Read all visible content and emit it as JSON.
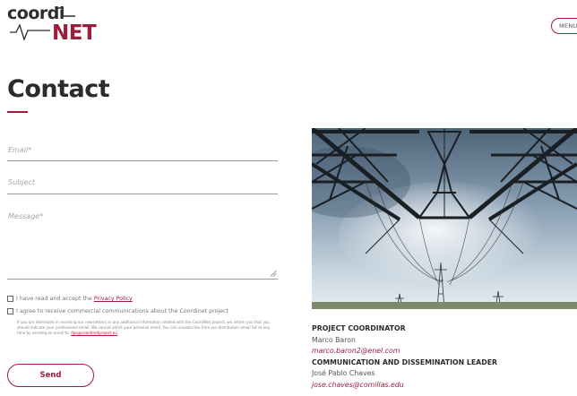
{
  "header": {
    "logo": {
      "part1": "coordi",
      "part2": "NET"
    },
    "menu_label": "MENU"
  },
  "page": {
    "title": "Contact"
  },
  "form": {
    "email_placeholder": "Email*",
    "subject_placeholder": "Subject",
    "message_placeholder": "Message*",
    "privacy_text": "I have read and accept the ",
    "privacy_link": "Privacy Policy",
    "commercial_text": "I agree to receive commercial communications about the Coordinet project",
    "notice_text": "If you are interested in receiving our newsletters or any additional information related with the CoordiNet project, we inform you that you should indicate your professional email. We cannot admit your personal email. You can unsubscribe from our distribution email list at any time by sending an email to:",
    "notice_email": "dpo@coordinetproject.eu",
    "send_label": "Send"
  },
  "contacts": [
    {
      "role": "PROJECT COORDINATOR",
      "name": "Marco Baron",
      "email": "marco.baron2@enel.com"
    },
    {
      "role": "COMMUNICATION AND DISSEMINATION LEADER",
      "name": "José Pablo Chaves",
      "email": "jose.chaves@comillas.edu"
    }
  ],
  "colors": {
    "accent": "#9e1c3c",
    "text": "#2b2b2b",
    "muted": "#a6a6a6"
  },
  "icons": {
    "resize_handle": "resize-handle-icon",
    "photo": "power-tower-photo"
  }
}
